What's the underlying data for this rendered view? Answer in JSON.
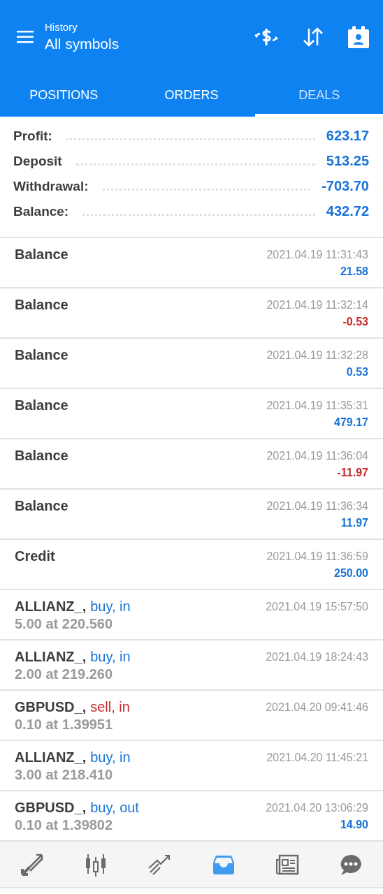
{
  "header": {
    "subtitle": "History",
    "title": "All symbols",
    "actions": [
      {
        "kind": "currency"
      },
      {
        "kind": "sort"
      },
      {
        "kind": "calendar"
      }
    ]
  },
  "tabs": [
    {
      "label": "POSITIONS",
      "selected": false
    },
    {
      "label": "ORDERS",
      "selected": false
    },
    {
      "label": "DEALS",
      "selected": true
    }
  ],
  "summary": [
    {
      "label": "Profit:",
      "value": "623.17"
    },
    {
      "label": "Deposit",
      "value": "513.25"
    },
    {
      "label": "Withdrawal:",
      "value": "-703.70"
    },
    {
      "label": "Balance:",
      "value": "432.72"
    }
  ],
  "deals": [
    {
      "kind": "balance",
      "title": "Balance",
      "time": "2021.04.19 11:31:43",
      "amount": {
        "text": "21.58",
        "color": "#1a73d9"
      }
    },
    {
      "kind": "balance",
      "title": "Balance",
      "time": "2021.04.19 11:32:14",
      "amount": {
        "text": "-0.53",
        "color": "#c62828"
      }
    },
    {
      "kind": "balance",
      "title": "Balance",
      "time": "2021.04.19 11:32:28",
      "amount": {
        "text": "0.53",
        "color": "#1a73d9"
      }
    },
    {
      "kind": "balance",
      "title": "Balance",
      "time": "2021.04.19 11:35:31",
      "amount": {
        "text": "479.17",
        "color": "#1a73d9"
      }
    },
    {
      "kind": "balance",
      "title": "Balance",
      "time": "2021.04.19 11:36:04",
      "amount": {
        "text": "-11.97",
        "color": "#c62828"
      }
    },
    {
      "kind": "balance",
      "title": "Balance",
      "time": "2021.04.19 11:36:34",
      "amount": {
        "text": "11.97",
        "color": "#1a73d9"
      }
    },
    {
      "kind": "balance",
      "title": "Credit",
      "time": "2021.04.19 11:36:59",
      "amount": {
        "text": "250.00",
        "color": "#1a73d9"
      }
    },
    {
      "kind": "trade",
      "symbol": "ALLIANZ_,",
      "action": {
        "text": "buy, in",
        "color": "#1a73d9"
      },
      "volume": "5.00 at 220.560",
      "time": "2021.04.19 15:57:50"
    },
    {
      "kind": "trade",
      "symbol": "ALLIANZ_,",
      "action": {
        "text": "buy, in",
        "color": "#1a73d9"
      },
      "volume": "2.00 at 219.260",
      "time": "2021.04.19 18:24:43"
    },
    {
      "kind": "trade",
      "symbol": "GBPUSD_,",
      "action": {
        "text": "sell, in",
        "color": "#c62828"
      },
      "volume": "0.10 at 1.39951",
      "time": "2021.04.20 09:41:46"
    },
    {
      "kind": "trade",
      "symbol": "ALLIANZ_,",
      "action": {
        "text": "buy, in",
        "color": "#1a73d9"
      },
      "volume": "3.00 at 218.410",
      "time": "2021.04.20 11:45:21"
    },
    {
      "kind": "trade",
      "symbol": "GBPUSD_,",
      "action": {
        "text": "buy, out",
        "color": "#1a73d9"
      },
      "volume": "0.10 at 1.39802",
      "time": "2021.04.20 13:06:29",
      "amount": {
        "text": "14.90",
        "color": "#1a73d9"
      }
    }
  ],
  "nav": [
    {
      "kind": "trade",
      "selected": false
    },
    {
      "kind": "chart",
      "selected": false
    },
    {
      "kind": "signals",
      "selected": false
    },
    {
      "kind": "inbox",
      "selected": true
    },
    {
      "kind": "news",
      "selected": false
    },
    {
      "kind": "chat",
      "selected": false
    }
  ]
}
